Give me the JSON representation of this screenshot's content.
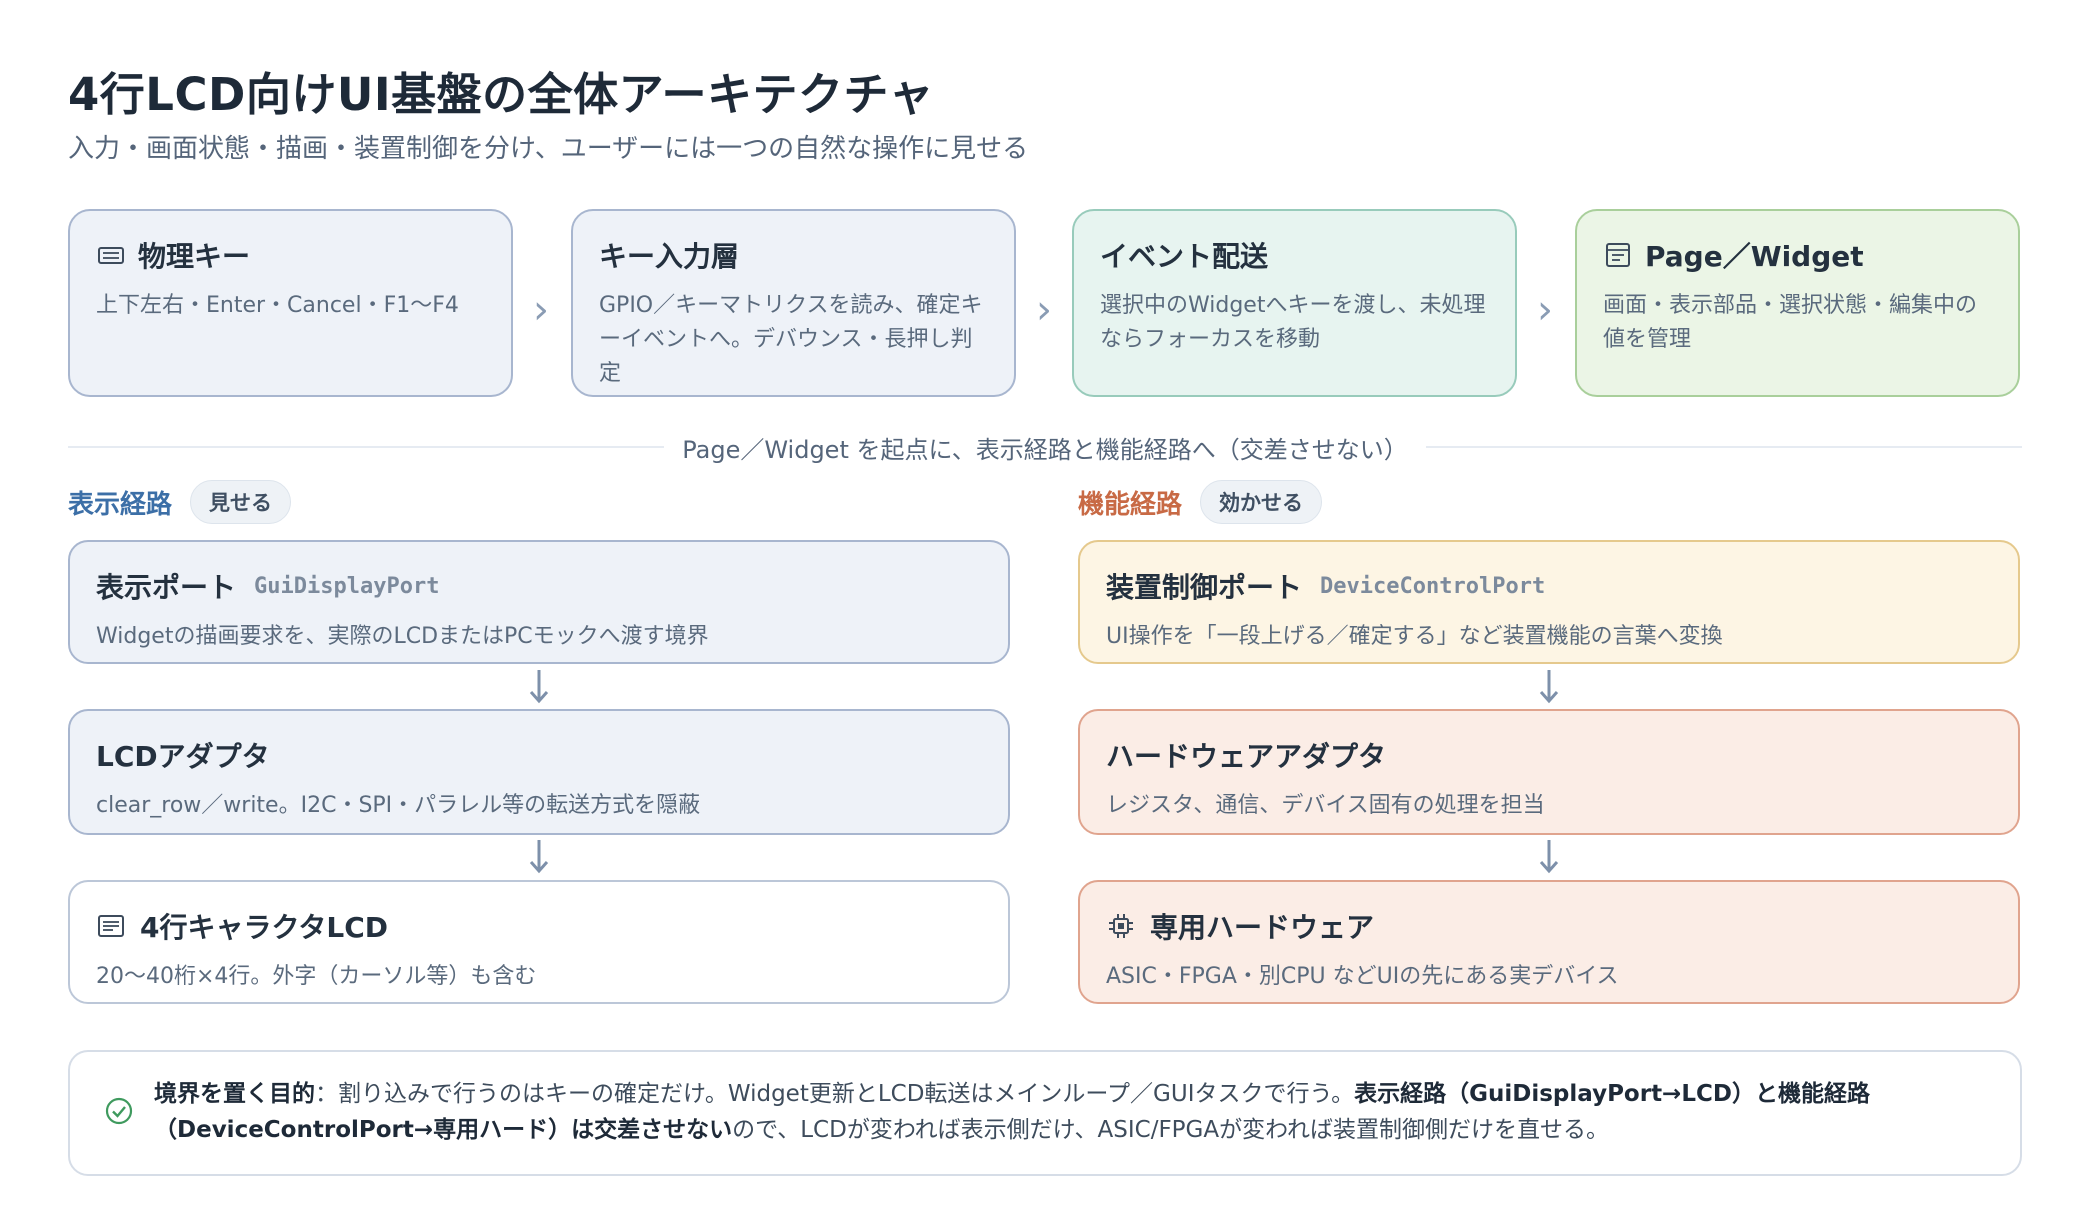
{
  "title": "4行LCD向けUI基盤の全体アーキテクチャ",
  "subtitle": "入力・画面状態・描画・装置制御を分け、ユーザーには一つの自然な操作に見せる",
  "flow": [
    {
      "icon": "keyboard-icon",
      "title": "物理キー",
      "desc": "上下左右・Enter・Cancel・F1〜F4"
    },
    {
      "title": "キー入力層",
      "desc": "GPIO／キーマトリクスを読み、確定キーイベントへ。デバウンス・長押し判定"
    },
    {
      "title": "イベント配送",
      "desc": "選択中のWidgetへキーを渡し、未処理ならフォーカスを移動"
    },
    {
      "icon": "document-icon",
      "title": "Page／Widget",
      "desc": "画面・表示部品・選択状態・編集中の値を管理"
    }
  ],
  "chevron": "›",
  "divider_label": "Page／Widget を起点に、表示経路と機能経路へ（交差させない）",
  "display_path": {
    "title": "表示経路",
    "badge": "見せる",
    "cards": [
      {
        "title": "表示ポート",
        "code": "GuiDisplayPort",
        "desc": "Widgetの描画要求を、実際のLCDまたはPCモックへ渡す境界"
      },
      {
        "title": "LCDアダプタ",
        "desc": "clear_row／write。I2C・SPI・パラレル等の転送方式を隠蔽"
      },
      {
        "icon": "lcd-icon",
        "title": "4行キャラクタLCD",
        "desc": "20〜40桁×4行。外字（カーソル等）も含む"
      }
    ]
  },
  "control_path": {
    "title": "機能経路",
    "badge": "効かせる",
    "cards": [
      {
        "title": "装置制御ポート",
        "code": "DeviceControlPort",
        "desc": "UI操作を「一段上げる／確定する」など装置機能の言葉へ変換"
      },
      {
        "title": "ハードウェアアダプタ",
        "desc": "レジスタ、通信、デバイス固有の処理を担当"
      },
      {
        "icon": "chip-icon",
        "title": "専用ハードウェア",
        "desc": "ASIC・FPGA・別CPU などUIの先にある実デバイス"
      }
    ]
  },
  "note": {
    "icon": "check-circle-icon",
    "label": "境界を置く目的",
    "sep": "：",
    "t1": "割り込みで行うのはキーの確定だけ。Widget更新とLCD転送はメインループ／GUIタスクで行う。",
    "b1": "表示経路（GuiDisplayPort→LCD）と機能経路（DeviceControlPort→専用ハード）は交差させない",
    "t2": "ので、LCDが変われば表示側だけ、ASIC/FPGAが変われば装置制御側だけを直せる。"
  },
  "colors": {
    "display": "#3c6fa7",
    "control": "#c86a45",
    "arrow": "#7d90aa"
  }
}
